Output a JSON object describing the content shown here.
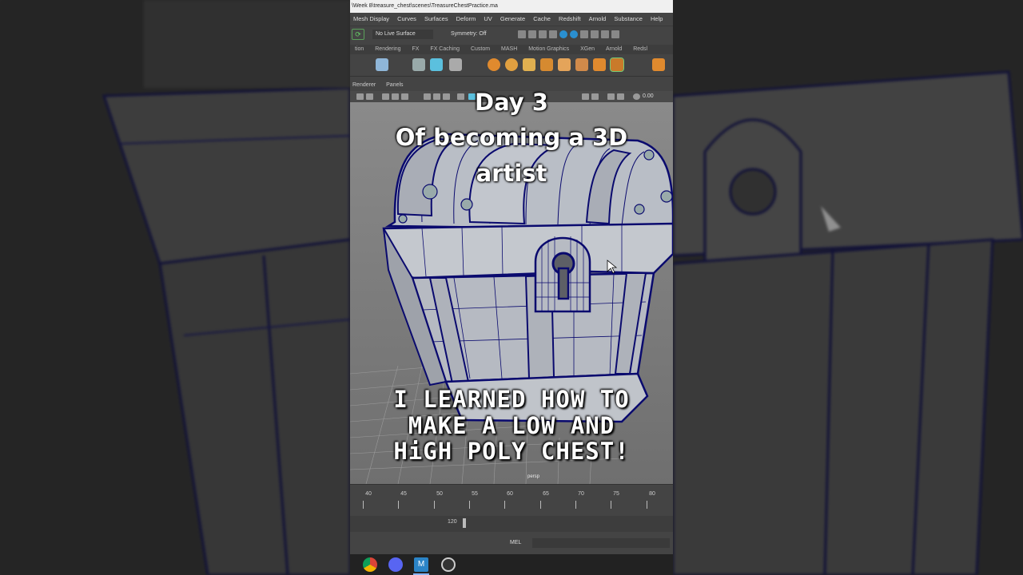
{
  "window": {
    "title": "\\Week 8\\treasure_chest\\scenes\\TreasureChestPractice.ma"
  },
  "menubar": [
    "Mesh Display",
    "Curves",
    "Surfaces",
    "Deform",
    "UV",
    "Generate",
    "Cache",
    "Redshift",
    "Arnold",
    "Substance",
    "Help"
  ],
  "statusline": {
    "live_surface": "No Live Surface",
    "symmetry": "Symmetry: Off"
  },
  "shelf_tabs": [
    "tion",
    "Rendering",
    "FX",
    "FX Caching",
    "Custom",
    "MASH",
    "Motion Graphics",
    "XGen",
    "Arnold",
    "Redsl"
  ],
  "panel_menu": [
    "Renderer",
    "Panels"
  ],
  "panel_tools": {
    "value": "0.00"
  },
  "viewport": {
    "camera_label": "persp"
  },
  "overlay": {
    "title_lines": [
      "Day 3",
      "Of becoming a 3D",
      "artist"
    ],
    "caption_lines": [
      "I LEARNED HOW TO",
      "MAKE A LOW AND",
      "HiGH POLY CHEST!"
    ]
  },
  "timeline": {
    "ticks": [
      "40",
      "45",
      "50",
      "55",
      "60",
      "65",
      "70",
      "75",
      "80"
    ]
  },
  "range": {
    "end": "120"
  },
  "command_line": {
    "language": "MEL"
  },
  "taskbar": {
    "apps": [
      "chrome-icon",
      "discord-icon",
      "maya-icon",
      "obs-icon"
    ]
  },
  "colors": {
    "wire": "#0a0a6e",
    "mesh": "#b8bcc4",
    "viewport_top": "#8a8a8a"
  }
}
